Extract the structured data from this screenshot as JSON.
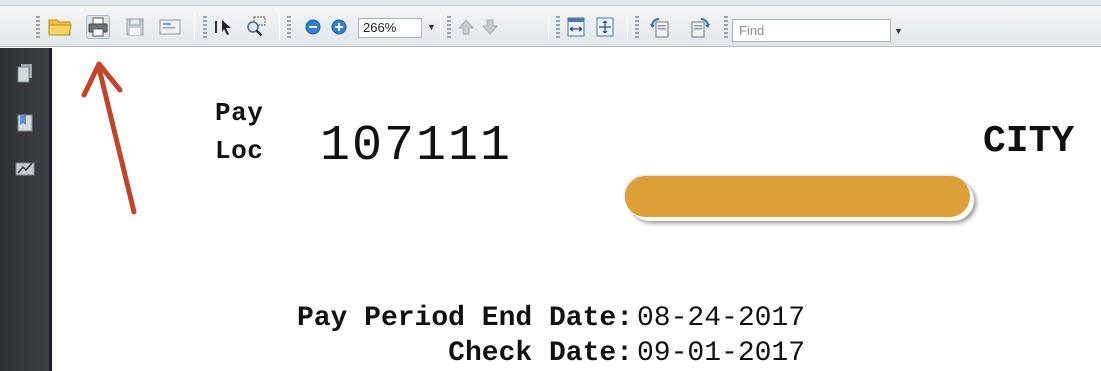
{
  "toolbar": {
    "zoom_value": "266%",
    "find_placeholder": "Find",
    "icons": [
      "open-folder-icon",
      "print-icon",
      "save-icon",
      "email-icon",
      "select-tool-icon",
      "marquee-zoom-icon",
      "zoom-out-icon",
      "zoom-in-icon",
      "previous-page-icon",
      "next-page-icon",
      "fit-width-icon",
      "fit-page-icon",
      "rotate-counterclockwise-icon",
      "rotate-clockwise-icon"
    ]
  },
  "nav_pane": {
    "icons": [
      "pages-icon",
      "bookmarks-icon",
      "signatures-icon"
    ]
  },
  "document": {
    "pay_loc_label_line1": "Pay",
    "pay_loc_label_line2": "Loc",
    "pay_loc_value": "107111",
    "city_text": "CITY",
    "pay_period_end_label": "Pay Period End Date:",
    "pay_period_end_value": "08-24-2017",
    "check_date_label": "Check Date:",
    "check_date_value": "09-01-2017"
  },
  "colors": {
    "redaction": "#dd9f37",
    "annotation_arrow": "#c0462a",
    "nav_pane": "#34383d"
  }
}
